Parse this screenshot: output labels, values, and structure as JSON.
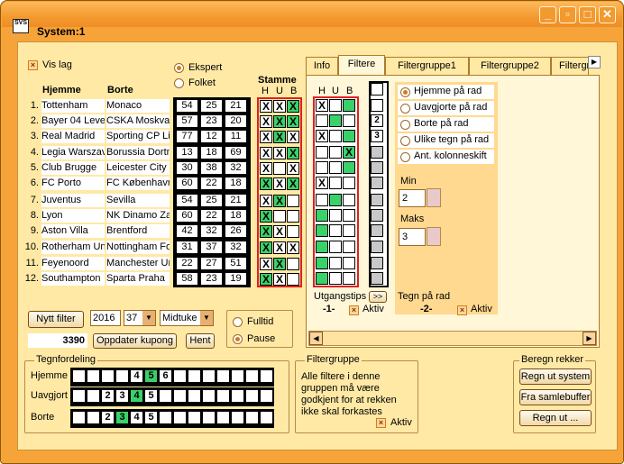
{
  "window": {
    "title": "System:1",
    "app_icon": "SVS",
    "controls": [
      "minimize",
      "restore",
      "maximize",
      "close"
    ]
  },
  "options": {
    "vis_lag": "Vis lag",
    "mode": [
      "Ekspert",
      "Folket"
    ],
    "mode_selected": "Ekspert"
  },
  "match_headers": {
    "home": "Hjemme",
    "away": "Borte",
    "stamme": "Stamme",
    "h": "H",
    "u": "U",
    "b": "B"
  },
  "matches": [
    {
      "n": "1.",
      "home": "Tottenham",
      "away": "Monaco",
      "p": [
        "54",
        "25",
        "21"
      ],
      "s": [
        "X",
        "X",
        "X"
      ],
      "sg": [
        0,
        0,
        1
      ],
      "f": [
        "X",
        "",
        ""
      ],
      "fg": [
        0,
        0,
        1
      ],
      "side": "",
      "sg2": 0
    },
    {
      "n": "2.",
      "home": "Bayer 04 Leve",
      "away": "CSKA Moskva",
      "p": [
        "57",
        "23",
        "20"
      ],
      "s": [
        "X",
        "X",
        "X"
      ],
      "sg": [
        0,
        1,
        1
      ],
      "f": [
        "",
        "",
        ""
      ],
      "fg": [
        0,
        1,
        0
      ],
      "side": "2",
      "sg2": 0
    },
    {
      "n": "3.",
      "home": "Real Madrid",
      "away": "Sporting CP Lis",
      "p": [
        "77",
        "12",
        "11"
      ],
      "s": [
        "X",
        "X",
        "X"
      ],
      "sg": [
        0,
        1,
        0
      ],
      "f": [
        "X",
        "",
        ""
      ],
      "fg": [
        0,
        0,
        1
      ],
      "side": "3",
      "sg2": 0
    },
    {
      "n": "4.",
      "home": "Legia Warszav",
      "away": "Borussia Dortm",
      "p": [
        "13",
        "18",
        "69"
      ],
      "s": [
        "X",
        "X",
        "X"
      ],
      "sg": [
        0,
        0,
        1
      ],
      "f": [
        "",
        "",
        "X"
      ],
      "fg": [
        0,
        0,
        1
      ],
      "side": "",
      "sg2": 1
    },
    {
      "n": "5.",
      "home": "Club Brugge",
      "away": "Leicester City",
      "p": [
        "30",
        "38",
        "32"
      ],
      "s": [
        "X",
        "",
        "X"
      ],
      "sg": [
        0,
        0,
        0
      ],
      "f": [
        "",
        "",
        ""
      ],
      "fg": [
        0,
        0,
        1
      ],
      "side": "",
      "sg2": 1
    },
    {
      "n": "6.",
      "home": "FC Porto",
      "away": "FC København",
      "p": [
        "60",
        "22",
        "18"
      ],
      "s": [
        "X",
        "X",
        "X"
      ],
      "sg": [
        1,
        0,
        1
      ],
      "f": [
        "X",
        "",
        ""
      ],
      "fg": [
        0,
        0,
        0
      ],
      "side": "",
      "sg2": 1
    },
    {
      "n": "7.",
      "home": "Juventus",
      "away": "Sevilla",
      "p": [
        "54",
        "25",
        "21"
      ],
      "s": [
        "X",
        "X",
        ""
      ],
      "sg": [
        0,
        1,
        0
      ],
      "f": [
        "",
        "",
        ""
      ],
      "fg": [
        0,
        1,
        0
      ],
      "side": "",
      "sg2": 1
    },
    {
      "n": "8.",
      "home": "Lyon",
      "away": "NK Dinamo Za",
      "p": [
        "60",
        "22",
        "18"
      ],
      "s": [
        "X",
        "",
        ""
      ],
      "sg": [
        1,
        0,
        0
      ],
      "f": [
        "",
        "",
        ""
      ],
      "fg": [
        1,
        0,
        0
      ],
      "side": "",
      "sg2": 1
    },
    {
      "n": "9.",
      "home": "Aston Villa",
      "away": "Brentford",
      "p": [
        "42",
        "32",
        "26"
      ],
      "s": [
        "X",
        "X",
        ""
      ],
      "sg": [
        1,
        0,
        0
      ],
      "f": [
        "",
        "",
        ""
      ],
      "fg": [
        1,
        0,
        0
      ],
      "side": "",
      "sg2": 1
    },
    {
      "n": "10.",
      "home": "Rotherham Un",
      "away": "Nottingham Fo",
      "p": [
        "31",
        "37",
        "32"
      ],
      "s": [
        "X",
        "X",
        "X"
      ],
      "sg": [
        1,
        0,
        0
      ],
      "f": [
        "",
        "",
        ""
      ],
      "fg": [
        1,
        0,
        0
      ],
      "side": "",
      "sg2": 1
    },
    {
      "n": "11.",
      "home": "Feyenoord",
      "away": "Manchester Ur",
      "p": [
        "22",
        "27",
        "51"
      ],
      "s": [
        "X",
        "X",
        ""
      ],
      "sg": [
        0,
        1,
        0
      ],
      "f": [
        "",
        "",
        ""
      ],
      "fg": [
        1,
        0,
        0
      ],
      "side": "",
      "sg2": 1
    },
    {
      "n": "12.",
      "home": "Southampton",
      "away": "Sparta Praha",
      "p": [
        "58",
        "23",
        "19"
      ],
      "s": [
        "X",
        "X",
        ""
      ],
      "sg": [
        1,
        0,
        0
      ],
      "f": [
        "",
        "",
        ""
      ],
      "fg": [
        1,
        0,
        0
      ],
      "side": "",
      "sg2": 1
    }
  ],
  "tabs": [
    "Info",
    "Filtere",
    "Filtergruppe1",
    "Filtergruppe2",
    "Filtergr"
  ],
  "active_tab": "Filtere",
  "filters": {
    "h": "H",
    "u": "U",
    "b": "B",
    "radios": [
      "Hjemme på rad",
      "Uavgjorte på rad",
      "Borte på rad",
      "Ulike tegn på rad",
      "Ant. kolonneskift"
    ],
    "selected": "Hjemme på rad",
    "min_label": "Min",
    "min_value": "2",
    "max_label": "Maks",
    "max_value": "3",
    "utgangstips": "Utgangstips",
    "utg_btn": ">>",
    "tegn_pa_rad": "Tegn på rad",
    "left_num": "-1-",
    "right_num": "-2-",
    "aktiv": "Aktiv"
  },
  "controls": {
    "nytt_filter": "Nytt filter",
    "year": "2016",
    "week": "37",
    "day": "Midtuke",
    "count": "3390",
    "oppdater": "Oppdater kupong",
    "hent": "Hent",
    "fulltid": "Fulltid",
    "pause": "Pause",
    "time_selected": "Pause"
  },
  "tegnfordeling": {
    "title": "Tegnfordeling",
    "rows": [
      {
        "label": "Hjemme",
        "cells": [
          "",
          "",
          "",
          "",
          "4",
          "5",
          "6"
        ],
        "green": 5
      },
      {
        "label": "Uavgjort",
        "cells": [
          "",
          "",
          "2",
          "3",
          "4",
          "5",
          ""
        ],
        "green": 4
      },
      {
        "label": "Borte",
        "cells": [
          "",
          "",
          "2",
          "3",
          "4",
          "5",
          ""
        ],
        "green": 3
      }
    ]
  },
  "filtergruppe": {
    "title": "Filtergruppe",
    "text": "Alle filtere i denne gruppen må være godkjent for at rekken ikke skal forkastes",
    "aktiv": "Aktiv"
  },
  "beregn": {
    "title": "Beregn rekker",
    "btn1": "Regn ut system",
    "btn2": "Fra samlebuffer",
    "btn3": "Regn ut ..."
  },
  "colors": {
    "frame": "#f6a43a",
    "client": "#ffe9a5",
    "green": "#3bd16a",
    "red": "#e02020"
  }
}
